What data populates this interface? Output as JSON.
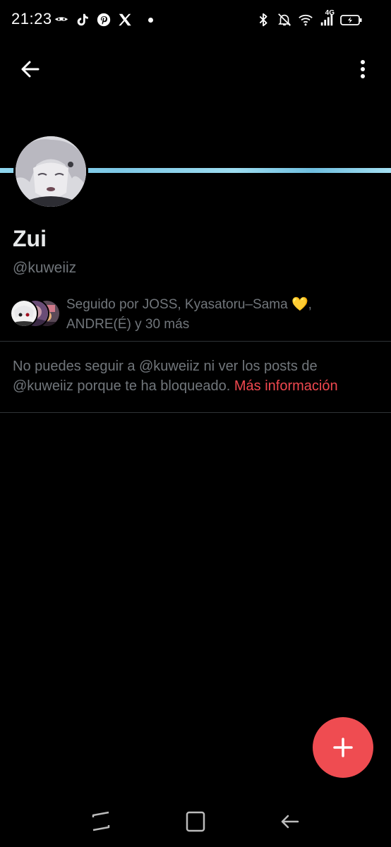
{
  "status_bar": {
    "time": "21:23",
    "network": "4G",
    "left_icons": [
      "eye-mask-icon",
      "tiktok-icon",
      "pinterest-icon",
      "x-icon",
      "notification-dot"
    ],
    "right_icons": [
      "bluetooth-icon",
      "notifications-off-icon",
      "wifi-icon",
      "signal-icon",
      "battery-icon"
    ]
  },
  "nav": {
    "back_icon": "arrow-left-icon",
    "more_icon": "more-vertical-icon"
  },
  "profile": {
    "display_name": "Zui",
    "handle": "@kuweiiz",
    "followed_by_text": "Seguido por JOSS, Kyasatoru–Sama 💛, ANDRE(É) y 30 más"
  },
  "blocked": {
    "message": "No puedes seguir a @kuweiiz ni ver los posts de @kuweiiz porque te ha bloqueado. ",
    "link": "Más información"
  },
  "fab": {
    "icon": "plus-icon"
  },
  "system_nav": {
    "icons": [
      "recents-icon",
      "home-icon",
      "back-icon"
    ]
  },
  "colors": {
    "background": "#000000",
    "text_primary": "#e7e9ea",
    "text_secondary": "#71767b",
    "accent_red": "#ef4c51",
    "banner": "#8fd6ee",
    "divider": "#2f3336"
  }
}
